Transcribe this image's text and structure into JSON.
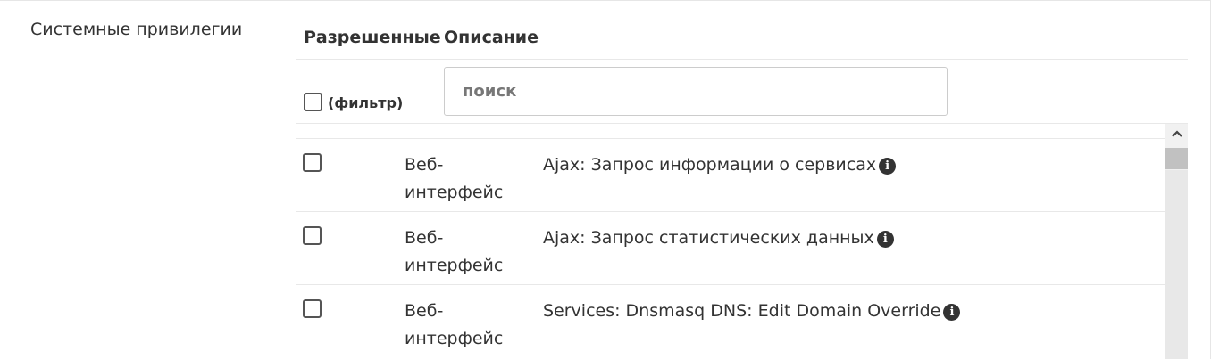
{
  "section": {
    "label": "Системные привилегии"
  },
  "table": {
    "headers": {
      "allowed": "Разрешенные",
      "description": "Описание"
    },
    "filter": {
      "label": "(фильтр)",
      "checked": false
    },
    "search": {
      "placeholder": "поиск",
      "value": ""
    },
    "rows": [
      {
        "checked": false,
        "type": "Веб-интерфейс",
        "description": "Ajax: Запрос информации о сервисах",
        "info_icon": "info-circle-icon"
      },
      {
        "checked": false,
        "type": "Веб-интерфейс",
        "description": "Ajax: Запрос статистических данных",
        "info_icon": "info-circle-icon"
      },
      {
        "checked": false,
        "type": "Веб-интерфейс",
        "description": "Services: Dnsmasq DNS: Edit Domain Override",
        "info_icon": "info-circle-icon"
      }
    ]
  },
  "colors": {
    "text": "#333333",
    "border": "#e8e8e8",
    "scrollbar_track": "#f1f1f1",
    "scrollbar_thumb": "#c1c1c1"
  }
}
